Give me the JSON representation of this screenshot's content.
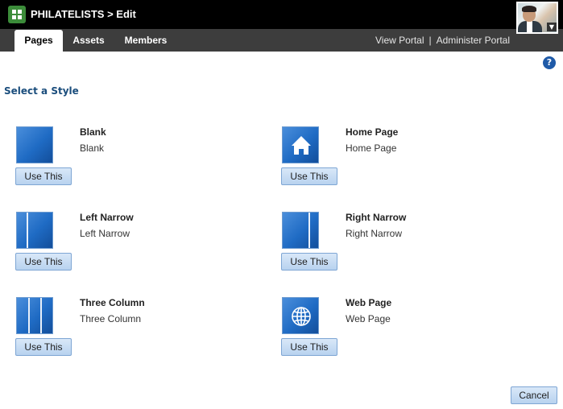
{
  "header": {
    "title": "PHILATELISTS > Edit",
    "logo_icon": "app-grid-icon",
    "avatar_icon": "user-photo"
  },
  "tabs": [
    {
      "label": "Pages",
      "active": true
    },
    {
      "label": "Assets",
      "active": false
    },
    {
      "label": "Members",
      "active": false
    }
  ],
  "links": {
    "view_portal": "View Portal",
    "separator": "|",
    "administer_portal": "Administer Portal"
  },
  "help": {
    "label": "?"
  },
  "section_title": "Select a Style",
  "styles": [
    {
      "name": "Blank",
      "description": "Blank",
      "button": "Use This",
      "icon": "blank-layout-icon"
    },
    {
      "name": "Home Page",
      "description": "Home Page",
      "button": "Use This",
      "icon": "home-icon"
    },
    {
      "name": "Left Narrow",
      "description": "Left Narrow",
      "button": "Use This",
      "icon": "left-narrow-layout-icon"
    },
    {
      "name": "Right Narrow",
      "description": "Right Narrow",
      "button": "Use This",
      "icon": "right-narrow-layout-icon"
    },
    {
      "name": "Three Column",
      "description": "Three Column",
      "button": "Use This",
      "icon": "three-column-layout-icon"
    },
    {
      "name": "Web Page",
      "description": "Web Page",
      "button": "Use This",
      "icon": "globe-icon"
    }
  ],
  "cancel_label": "Cancel",
  "colors": {
    "topbar": "#000000",
    "tabbar": "#3d3d3d",
    "accent": "#1f6bc4",
    "section_title": "#1a4d7c",
    "logo": "#3c8c3a"
  }
}
